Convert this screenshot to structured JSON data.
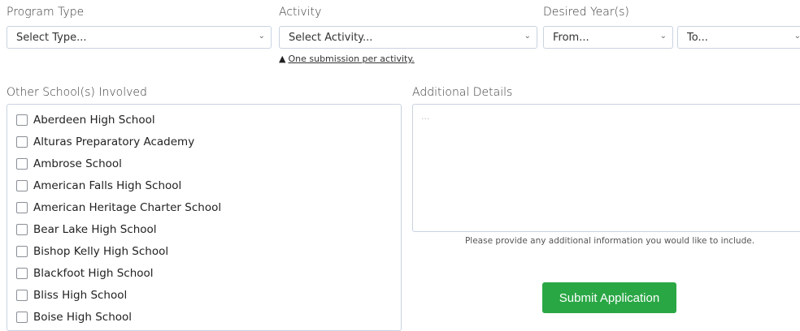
{
  "labels": {
    "program_type": "Program Type",
    "activity": "Activity",
    "desired_years": "Desired Year(s)",
    "other_schools": "Other School(s) Involved",
    "additional_details": "Additional Details"
  },
  "selects": {
    "program_type": "Select Type...",
    "activity": "Select Activity...",
    "year_from": "From...",
    "year_to": "To..."
  },
  "activity_note": "One submission per activity.",
  "schools": [
    "Aberdeen High School",
    "Alturas Preparatory Academy",
    "Ambrose School",
    "American Falls High School",
    "American Heritage Charter School",
    "Bear Lake High School",
    "Bishop Kelly High School",
    "Blackfoot High School",
    "Bliss High School",
    "Boise High School"
  ],
  "details_placeholder": "...",
  "details_help": "Please provide any additional information you would like to include.",
  "submit_label": "Submit Application",
  "icons": {
    "warning": "warning-icon",
    "chevron": "chevron-down-icon"
  },
  "colors": {
    "submit": "#2aa745",
    "border": "#c9d3e0"
  }
}
